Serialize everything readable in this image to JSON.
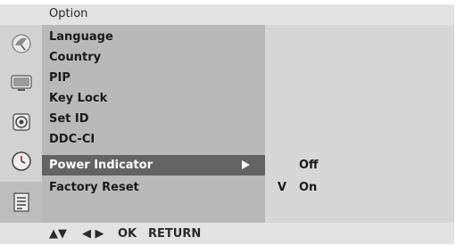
{
  "header": {
    "title": "Option"
  },
  "menu": {
    "items": [
      {
        "label": "Language"
      },
      {
        "label": "Country"
      },
      {
        "label": "PIP"
      },
      {
        "label": "Key Lock"
      },
      {
        "label": "Set ID"
      },
      {
        "label": "DDC-CI"
      },
      {
        "label": "Power Indicator",
        "selected": true
      },
      {
        "label": "Factory Reset"
      }
    ]
  },
  "submenu": {
    "options": [
      {
        "label": "Off",
        "check": ""
      },
      {
        "label": "On",
        "check": "V"
      }
    ]
  },
  "icons": [
    "satellite-dish-icon",
    "tv-screen-icon",
    "speaker-icon",
    "clock-icon",
    "option-list-icon"
  ],
  "help": {
    "updown": "▲▼",
    "leftright": "◀ ▶",
    "ok": "OK",
    "return": "RETURN"
  },
  "colors": {
    "selected_row": "#636363",
    "menu_background": "#b9b9b9",
    "submenu_background": "#d7d7d7",
    "header_background": "#e3e3e3"
  }
}
